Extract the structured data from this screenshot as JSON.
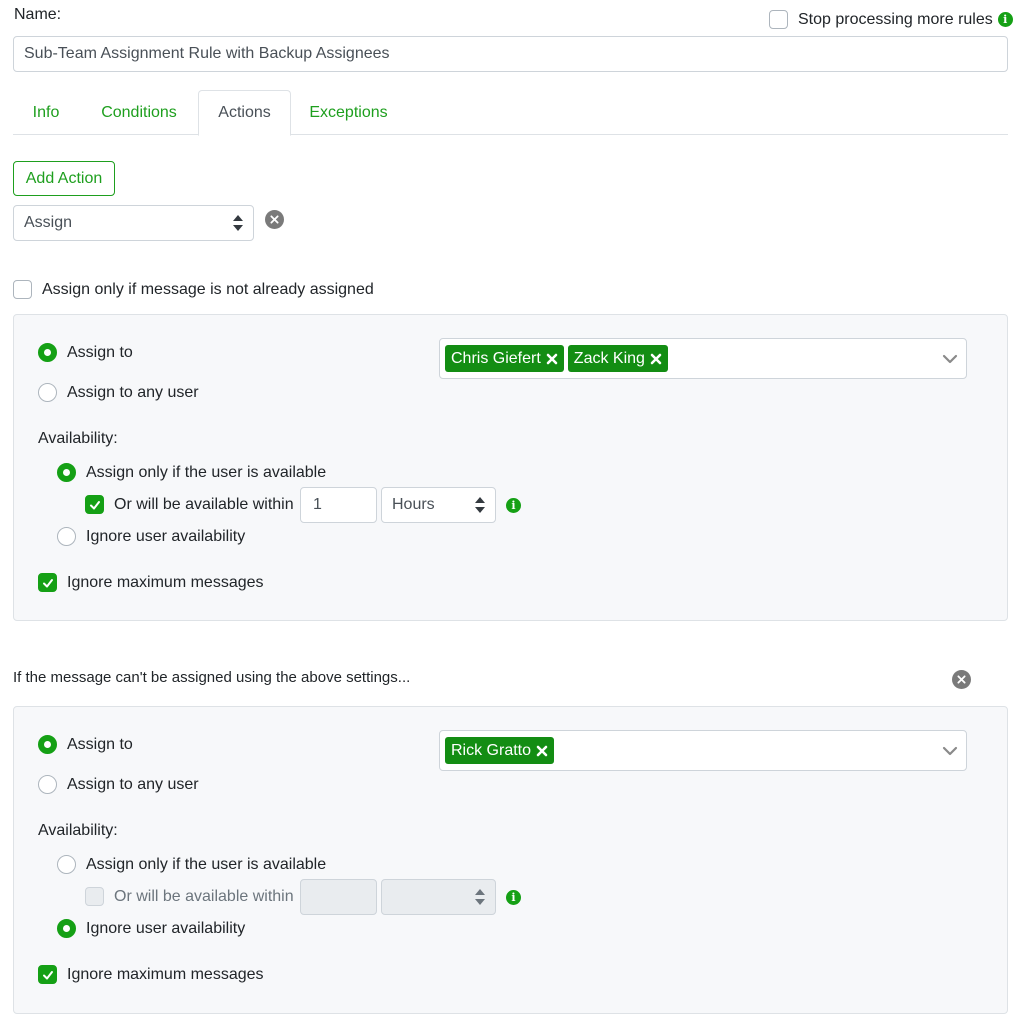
{
  "name": {
    "label": "Name:",
    "value": "Sub-Team Assignment Rule with Backup Assignees"
  },
  "stop_processing": {
    "label": "Stop processing more rules",
    "checked": false
  },
  "tabs": [
    {
      "label": "Info"
    },
    {
      "label": "Conditions"
    },
    {
      "label": "Actions",
      "active": true
    },
    {
      "label": "Exceptions"
    }
  ],
  "add_action_label": "Add Action",
  "action_select": {
    "value": "Assign"
  },
  "assign_only_unassigned": {
    "label": "Assign only if message is not already assigned",
    "checked": false
  },
  "primary": {
    "assign_to_label": "Assign to",
    "assign_to_any_label": "Assign to any user",
    "assignees": [
      "Chris Giefert",
      "Zack King"
    ],
    "availability_label": "Availability:",
    "only_if_available_label": "Assign only if the user is available",
    "within_label": "Or will be available within",
    "within_value": "1",
    "within_unit": "Hours",
    "ignore_availability_label": "Ignore user availability",
    "ignore_max_label": "Ignore maximum messages"
  },
  "fallback_text": "If the message can't be assigned using the above settings...",
  "backup": {
    "assign_to_label": "Assign to",
    "assign_to_any_label": "Assign to any user",
    "assignees": [
      "Rick Gratto"
    ],
    "availability_label": "Availability:",
    "only_if_available_label": "Assign only if the user is available",
    "within_label": "Or will be available within",
    "within_value": "",
    "within_unit": "",
    "ignore_availability_label": "Ignore user availability",
    "ignore_max_label": "Ignore maximum messages"
  },
  "colors": {
    "accent": "#1e9f1e",
    "tag": "#138d13",
    "panel_bg": "#f7f8fa"
  },
  "icons": {
    "info": "info-icon",
    "remove": "x-circle-icon",
    "check": "check-icon",
    "chevron": "chevron-down-icon",
    "updown": "updown-icon"
  }
}
